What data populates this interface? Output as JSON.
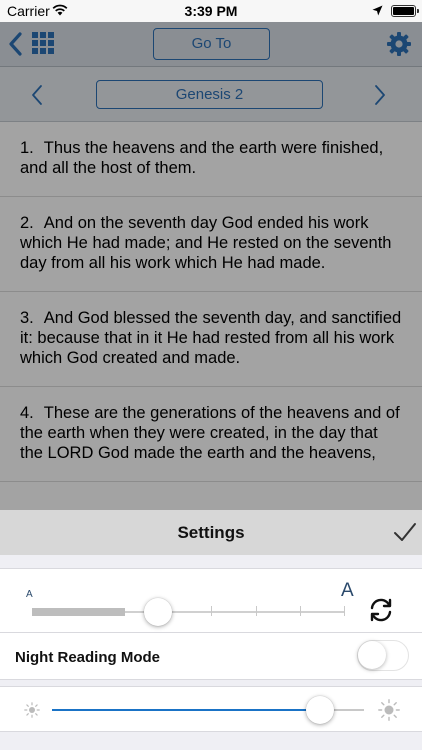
{
  "status_bar": {
    "carrier": "Carrier",
    "time": "3:39 PM"
  },
  "nav": {
    "goto_label": "Go To"
  },
  "chapter_nav": {
    "chapter": "Genesis 2"
  },
  "verses": [
    {
      "num": "1.",
      "text": "Thus the heavens and the earth were finished, and all the host of them."
    },
    {
      "num": "2.",
      "text": "And on the seventh day God ended his work which He had made; and He rested on the seventh day from all his work which He had made."
    },
    {
      "num": "3.",
      "text": "And God blessed the seventh day, and sanctified it: because that in it He had rested from all his work which God created and made."
    },
    {
      "num": "4.",
      "text": "These are the generations of the heavens and of the earth when they were created, in the day that the LORD God made the earth and the heavens,"
    }
  ],
  "settings": {
    "title": "Settings",
    "font_size": {
      "small_label": "A",
      "large_label": "A",
      "level": 0.4
    },
    "night_mode": {
      "label": "Night Reading Mode",
      "enabled": false
    },
    "brightness": {
      "level": 0.86
    }
  },
  "colors": {
    "accent": "#2d6fb5",
    "slider_accent": "#1a73c6"
  }
}
